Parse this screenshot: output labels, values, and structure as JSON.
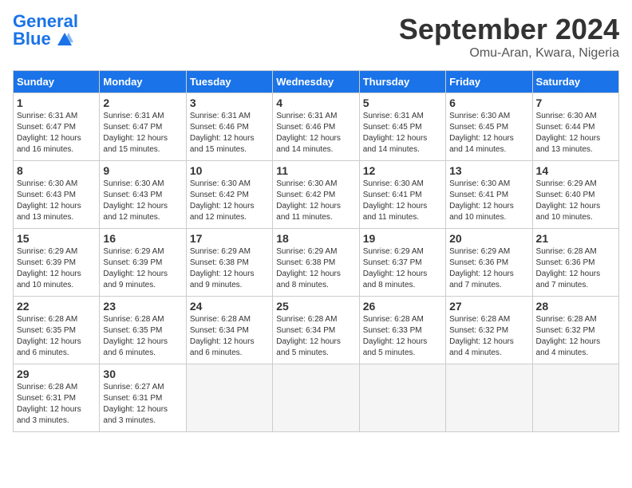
{
  "header": {
    "logo_general": "General",
    "logo_blue": "Blue",
    "month_title": "September 2024",
    "location": "Omu-Aran, Kwara, Nigeria"
  },
  "days_of_week": [
    "Sunday",
    "Monday",
    "Tuesday",
    "Wednesday",
    "Thursday",
    "Friday",
    "Saturday"
  ],
  "weeks": [
    [
      {
        "day": 1,
        "sunrise": "6:31 AM",
        "sunset": "6:47 PM",
        "daylight": "12 hours and 16 minutes."
      },
      {
        "day": 2,
        "sunrise": "6:31 AM",
        "sunset": "6:47 PM",
        "daylight": "12 hours and 15 minutes."
      },
      {
        "day": 3,
        "sunrise": "6:31 AM",
        "sunset": "6:46 PM",
        "daylight": "12 hours and 15 minutes."
      },
      {
        "day": 4,
        "sunrise": "6:31 AM",
        "sunset": "6:46 PM",
        "daylight": "12 hours and 14 minutes."
      },
      {
        "day": 5,
        "sunrise": "6:31 AM",
        "sunset": "6:45 PM",
        "daylight": "12 hours and 14 minutes."
      },
      {
        "day": 6,
        "sunrise": "6:30 AM",
        "sunset": "6:45 PM",
        "daylight": "12 hours and 14 minutes."
      },
      {
        "day": 7,
        "sunrise": "6:30 AM",
        "sunset": "6:44 PM",
        "daylight": "12 hours and 13 minutes."
      }
    ],
    [
      {
        "day": 8,
        "sunrise": "6:30 AM",
        "sunset": "6:43 PM",
        "daylight": "12 hours and 13 minutes."
      },
      {
        "day": 9,
        "sunrise": "6:30 AM",
        "sunset": "6:43 PM",
        "daylight": "12 hours and 12 minutes."
      },
      {
        "day": 10,
        "sunrise": "6:30 AM",
        "sunset": "6:42 PM",
        "daylight": "12 hours and 12 minutes."
      },
      {
        "day": 11,
        "sunrise": "6:30 AM",
        "sunset": "6:42 PM",
        "daylight": "12 hours and 11 minutes."
      },
      {
        "day": 12,
        "sunrise": "6:30 AM",
        "sunset": "6:41 PM",
        "daylight": "12 hours and 11 minutes."
      },
      {
        "day": 13,
        "sunrise": "6:30 AM",
        "sunset": "6:41 PM",
        "daylight": "12 hours and 10 minutes."
      },
      {
        "day": 14,
        "sunrise": "6:29 AM",
        "sunset": "6:40 PM",
        "daylight": "12 hours and 10 minutes."
      }
    ],
    [
      {
        "day": 15,
        "sunrise": "6:29 AM",
        "sunset": "6:39 PM",
        "daylight": "12 hours and 10 minutes."
      },
      {
        "day": 16,
        "sunrise": "6:29 AM",
        "sunset": "6:39 PM",
        "daylight": "12 hours and 9 minutes."
      },
      {
        "day": 17,
        "sunrise": "6:29 AM",
        "sunset": "6:38 PM",
        "daylight": "12 hours and 9 minutes."
      },
      {
        "day": 18,
        "sunrise": "6:29 AM",
        "sunset": "6:38 PM",
        "daylight": "12 hours and 8 minutes."
      },
      {
        "day": 19,
        "sunrise": "6:29 AM",
        "sunset": "6:37 PM",
        "daylight": "12 hours and 8 minutes."
      },
      {
        "day": 20,
        "sunrise": "6:29 AM",
        "sunset": "6:36 PM",
        "daylight": "12 hours and 7 minutes."
      },
      {
        "day": 21,
        "sunrise": "6:28 AM",
        "sunset": "6:36 PM",
        "daylight": "12 hours and 7 minutes."
      }
    ],
    [
      {
        "day": 22,
        "sunrise": "6:28 AM",
        "sunset": "6:35 PM",
        "daylight": "12 hours and 6 minutes."
      },
      {
        "day": 23,
        "sunrise": "6:28 AM",
        "sunset": "6:35 PM",
        "daylight": "12 hours and 6 minutes."
      },
      {
        "day": 24,
        "sunrise": "6:28 AM",
        "sunset": "6:34 PM",
        "daylight": "12 hours and 6 minutes."
      },
      {
        "day": 25,
        "sunrise": "6:28 AM",
        "sunset": "6:34 PM",
        "daylight": "12 hours and 5 minutes."
      },
      {
        "day": 26,
        "sunrise": "6:28 AM",
        "sunset": "6:33 PM",
        "daylight": "12 hours and 5 minutes."
      },
      {
        "day": 27,
        "sunrise": "6:28 AM",
        "sunset": "6:32 PM",
        "daylight": "12 hours and 4 minutes."
      },
      {
        "day": 28,
        "sunrise": "6:28 AM",
        "sunset": "6:32 PM",
        "daylight": "12 hours and 4 minutes."
      }
    ],
    [
      {
        "day": 29,
        "sunrise": "6:28 AM",
        "sunset": "6:31 PM",
        "daylight": "12 hours and 3 minutes."
      },
      {
        "day": 30,
        "sunrise": "6:27 AM",
        "sunset": "6:31 PM",
        "daylight": "12 hours and 3 minutes."
      },
      null,
      null,
      null,
      null,
      null
    ]
  ]
}
